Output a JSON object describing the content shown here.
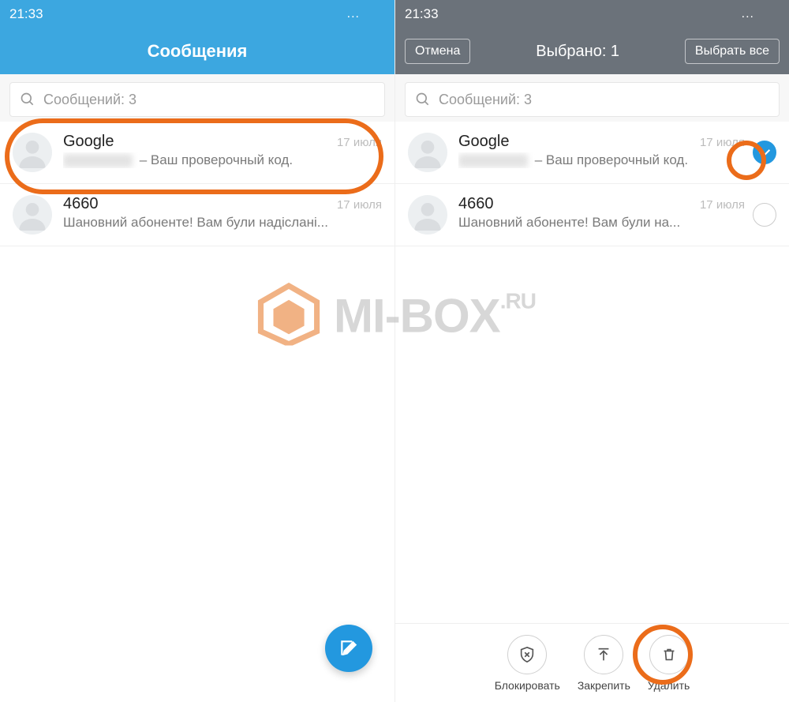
{
  "statusbar": {
    "time": "21:33",
    "icons_text": "..."
  },
  "left": {
    "header_title": "Сообщения",
    "search_placeholder": "Сообщений: 3",
    "messages": [
      {
        "sender": "Google",
        "date": "17 июля",
        "preview_suffix": " – Ваш проверочный код."
      },
      {
        "sender": "4660",
        "date": "17 июля",
        "preview": "Шановний абоненте! Вам були надіслані..."
      }
    ]
  },
  "right": {
    "cancel_label": "Отмена",
    "title": "Выбрано: 1",
    "select_all_label": "Выбрать все",
    "search_placeholder": "Сообщений: 3",
    "messages": [
      {
        "sender": "Google",
        "date": "17 июля",
        "preview_suffix": " – Ваш проверочный код."
      },
      {
        "sender": "4660",
        "date": "17 июля",
        "preview": "Шановний абоненте! Вам були на..."
      }
    ],
    "actions": {
      "block": "Блокировать",
      "pin": "Закрепить",
      "delete": "Удалить"
    }
  },
  "watermark": {
    "text_main": "MI-BOX",
    "text_suffix": ".RU"
  }
}
